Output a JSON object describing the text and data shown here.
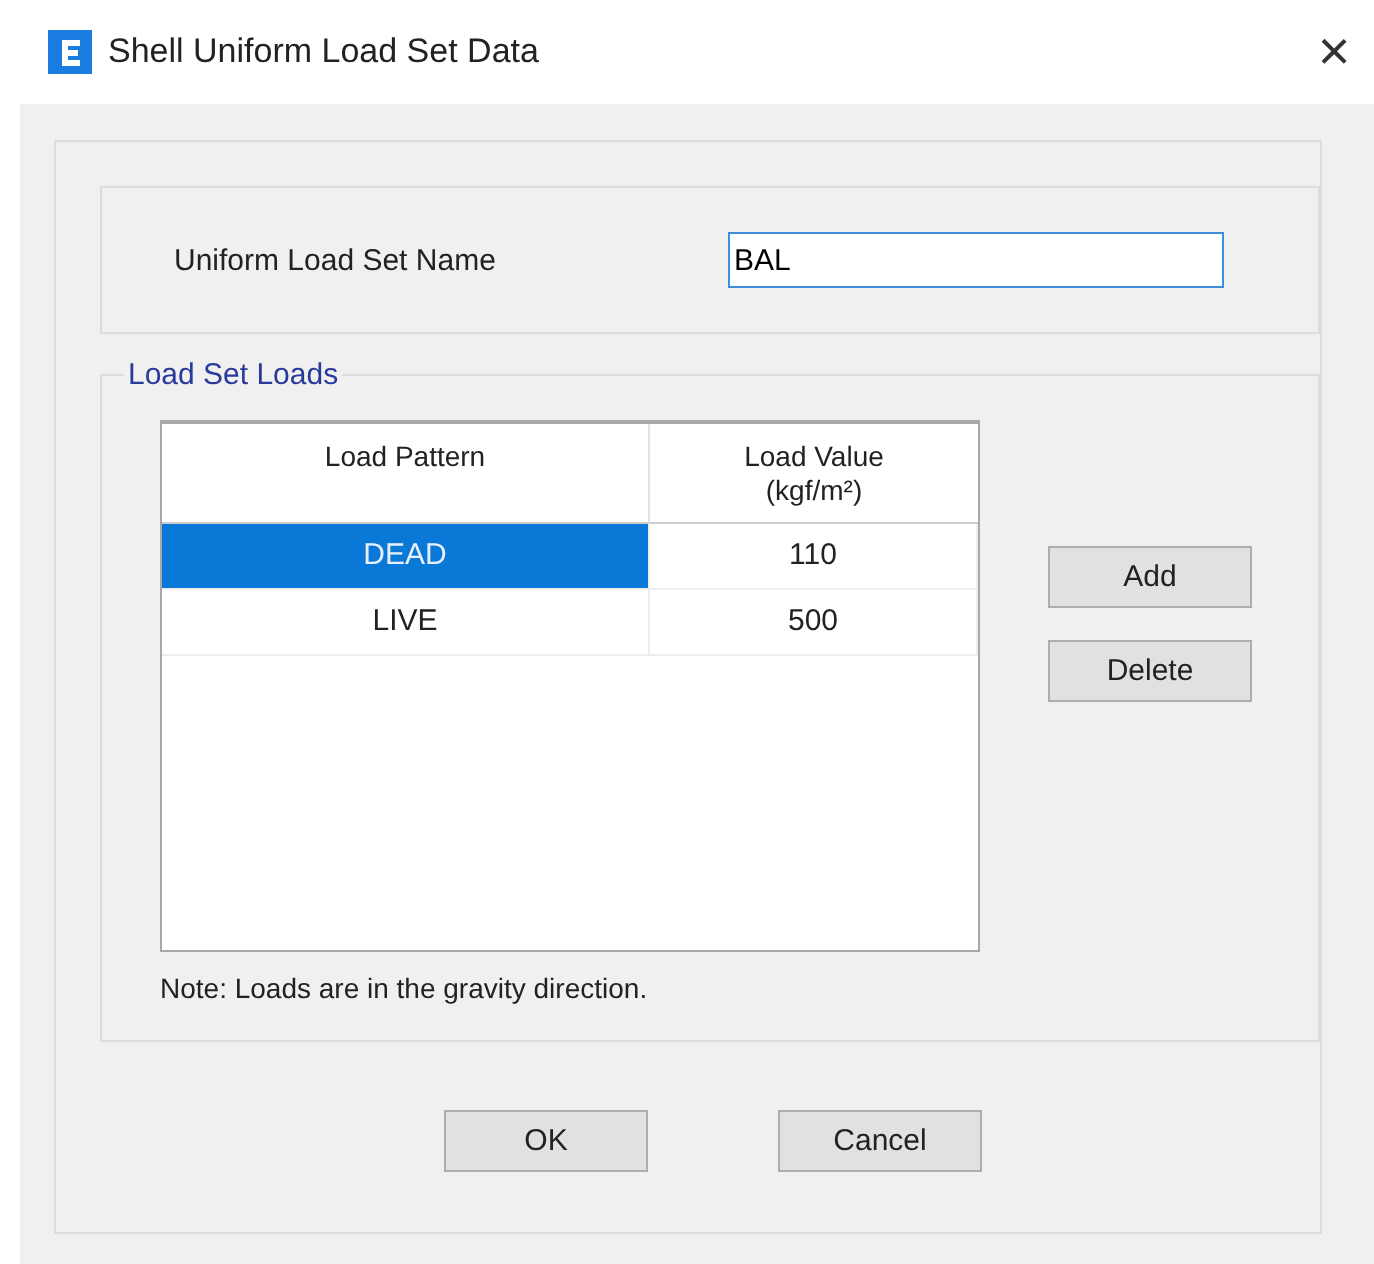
{
  "window": {
    "title": "Shell Uniform Load Set Data",
    "close": "×"
  },
  "name_field": {
    "label": "Uniform Load Set Name",
    "value": "BAL"
  },
  "load_set": {
    "title": "Load Set Loads",
    "columns": [
      "Load Pattern",
      "Load Value (kgf/m²)"
    ],
    "rows": [
      {
        "pattern": "DEAD",
        "value": "110",
        "selected": true
      },
      {
        "pattern": "LIVE",
        "value": "500",
        "selected": false
      }
    ],
    "note": "Note:  Loads are in the gravity direction.",
    "buttons": [
      "Add",
      "Delete"
    ]
  },
  "buttons": [
    "OK",
    "Cancel"
  ]
}
